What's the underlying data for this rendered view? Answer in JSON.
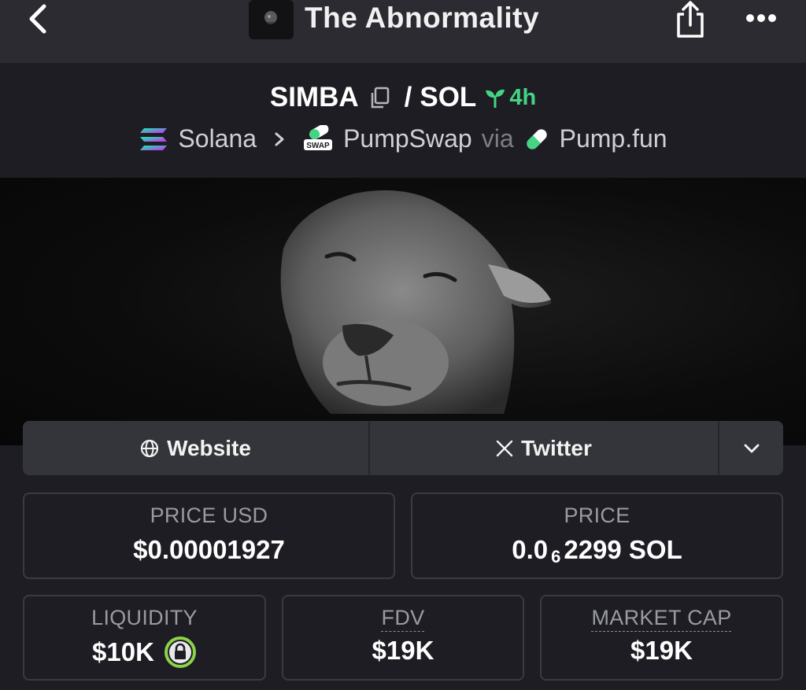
{
  "nav": {
    "title": "The Abnormality",
    "back_icon": "chevron-left-icon",
    "share_icon": "share-icon",
    "more_icon": "ellipsis-icon"
  },
  "pair": {
    "base": "SIMBA",
    "separator": "/",
    "quote": "SOL",
    "age": "4h",
    "age_color": "#45d483"
  },
  "chain": {
    "chain_name": "Solana",
    "dex_name": "PumpSwap",
    "via_label": "via",
    "launchpad_name": "Pump.fun"
  },
  "links": {
    "website_label": "Website",
    "twitter_label": "Twitter"
  },
  "stats": {
    "price_usd_label": "PRICE USD",
    "price_usd_value": "$0.00001927",
    "price_label": "PRICE",
    "price_prefix": "0.0",
    "price_zero_count": "6",
    "price_digits": "2299 SOL",
    "liquidity_label": "LIQUIDITY",
    "liquidity_value": "$10K",
    "fdv_label": "FDV",
    "fdv_value": "$19K",
    "market_cap_label": "MARKET CAP",
    "market_cap_value": "$19K"
  },
  "colors": {
    "accent_green": "#45d483",
    "lock_ring": "#8bd34a",
    "background": "#1d1d23"
  }
}
